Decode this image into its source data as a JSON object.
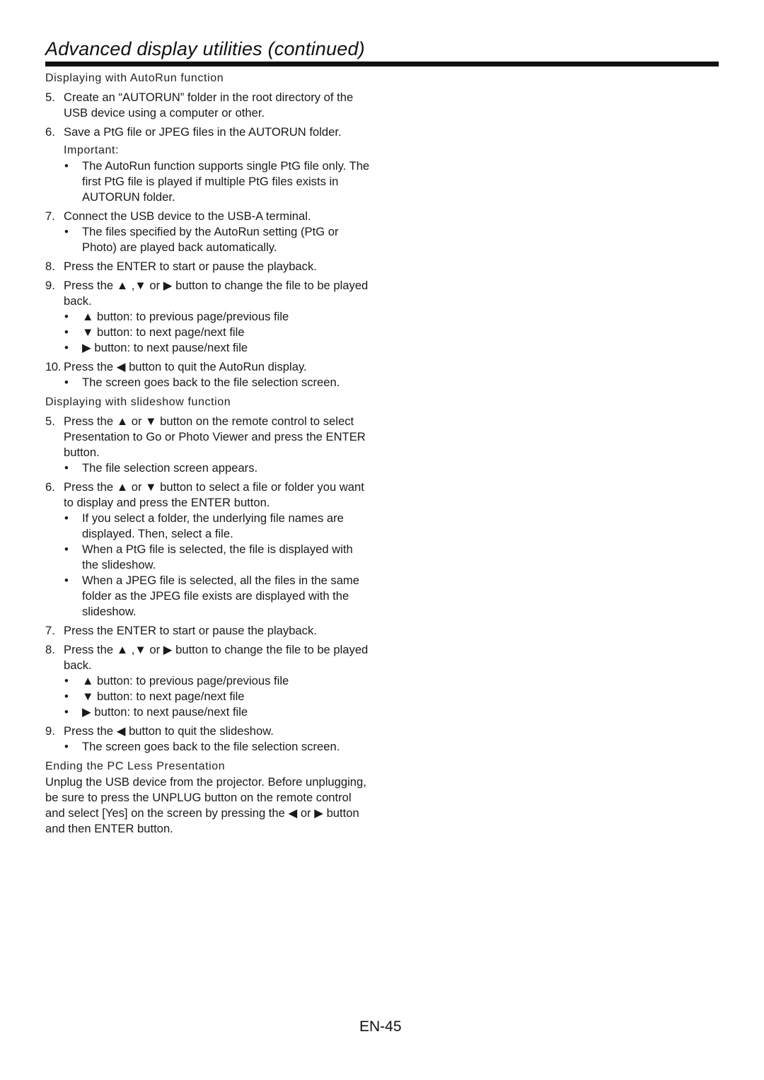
{
  "page": {
    "title": "Advanced display utilities (continued)",
    "page_number": "EN-45"
  },
  "autorun": {
    "heading": "Displaying with AutoRun function",
    "step5": {
      "num": "5.",
      "text": "Create an “AUTORUN” folder in the root directory of the USB device using a computer or other."
    },
    "step6": {
      "num": "6.",
      "text": "Save a PtG file or JPEG files in the AUTORUN folder."
    },
    "important_label": "Important:",
    "important_bullet": "The AutoRun function supports single PtG file only. The first PtG file is played if multiple PtG files exists in AUTORUN folder.",
    "step7": {
      "num": "7.",
      "text": "Connect the USB device to the USB-A terminal.",
      "bullet": "The files specified by the AutoRun setting (PtG or Photo) are played back automatically."
    },
    "step8": {
      "num": "8.",
      "text": "Press the ENTER to start or pause the playback."
    },
    "step9": {
      "num": "9.",
      "text": "Press the ▲ ,▼ or ▶ button to change the file to be played back.",
      "bullets": [
        "▲ button:  to previous page/previous file",
        "▼ button:  to next page/next file",
        "▶ button:  to next pause/next file"
      ]
    },
    "step10": {
      "num": "10.",
      "text": "Press the ◀ button to quit the AutoRun display.",
      "bullet": "The screen goes back to the file selection screen."
    }
  },
  "slideshow": {
    "heading": "Displaying with slideshow function",
    "step5": {
      "num": "5.",
      "text": "Press the ▲ or ▼ button on the remote control to select Presentation to Go or Photo Viewer and press the ENTER button.",
      "bullet": "The file selection screen appears."
    },
    "step6": {
      "num": "6.",
      "text": "Press the ▲ or ▼ button to select a file or folder you want to display and press the ENTER button.",
      "bullets": [
        "If you select a folder, the underlying file names are displayed. Then, select a file.",
        "When a PtG file is selected, the file is displayed with the slideshow.",
        "When a JPEG file is selected, all the files in the same folder as the JPEG file exists are displayed with the slideshow."
      ]
    },
    "step7": {
      "num": "7.",
      "text": "Press the ENTER to start or pause the playback."
    },
    "step8": {
      "num": "8.",
      "text": "Press the ▲ ,▼ or ▶ button to change the file to be played back.",
      "bullets": [
        "▲ button:  to previous page/previous file",
        "▼ button:  to next page/next file",
        "▶ button:  to next pause/next file"
      ]
    },
    "step9": {
      "num": "9.",
      "text": "Press the ◀ button to quit the slideshow.",
      "bullet": "The screen goes back to the file selection screen."
    }
  },
  "ending": {
    "heading": "Ending the PC Less Presentation",
    "text": "Unplug the USB device from the projector. Before unplugging, be sure to press the UNPLUG button on the remote control and select [Yes] on the screen by pressing the ◀ or ▶ button and then ENTER button."
  },
  "bullet_char": "•"
}
